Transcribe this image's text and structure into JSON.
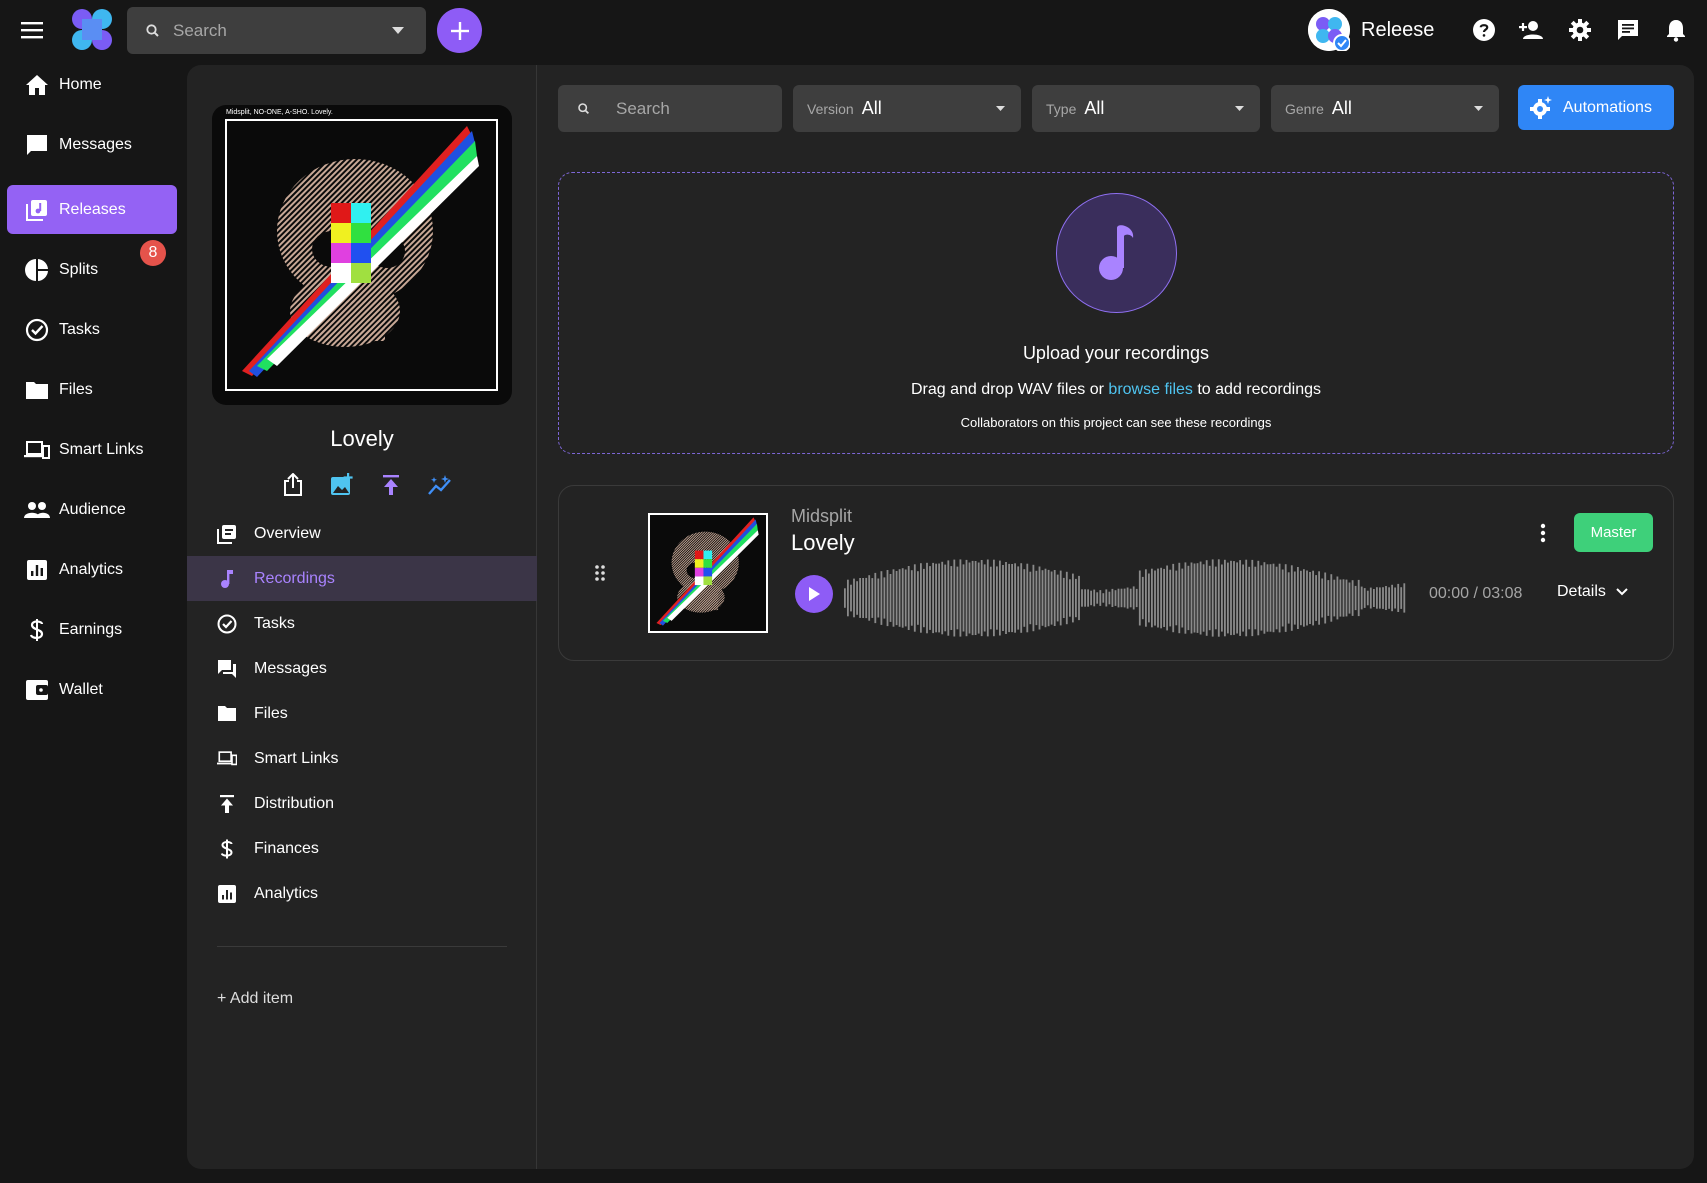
{
  "topbar": {
    "search_placeholder": "Search",
    "account_name": "Releese"
  },
  "sidebar": {
    "items": [
      {
        "label": "Home",
        "icon": "home-icon"
      },
      {
        "label": "Messages",
        "icon": "chat-icon"
      },
      {
        "label": "Releases",
        "icon": "releases-icon"
      },
      {
        "label": "Splits",
        "icon": "pie-icon"
      },
      {
        "label": "Tasks",
        "icon": "check-circle-icon"
      },
      {
        "label": "Files",
        "icon": "folder-icon"
      },
      {
        "label": "Smart Links",
        "icon": "devices-icon"
      },
      {
        "label": "Audience",
        "icon": "people-icon"
      },
      {
        "label": "Analytics",
        "icon": "analytics-icon"
      },
      {
        "label": "Earnings",
        "icon": "dollar-icon"
      },
      {
        "label": "Wallet",
        "icon": "wallet-icon"
      }
    ],
    "active": "Releases",
    "splits_badge": "8"
  },
  "release": {
    "cover_caption": "Midsplit, NO-ONE, A-SHO. Lovely.",
    "title": "Lovely",
    "menu": [
      {
        "label": "Overview",
        "icon": "overview-icon"
      },
      {
        "label": "Recordings",
        "icon": "music-note-icon"
      },
      {
        "label": "Tasks",
        "icon": "check-circle-icon"
      },
      {
        "label": "Messages",
        "icon": "forum-icon"
      },
      {
        "label": "Files",
        "icon": "folder-icon"
      },
      {
        "label": "Smart Links",
        "icon": "devices-icon"
      },
      {
        "label": "Distribution",
        "icon": "publish-icon"
      },
      {
        "label": "Finances",
        "icon": "dollar-icon"
      },
      {
        "label": "Analytics",
        "icon": "analytics-icon"
      }
    ],
    "active_menu": "Recordings",
    "add_item": "+ Add item"
  },
  "filters": {
    "search_placeholder": "Search",
    "version_label": "Version",
    "version_value": "All",
    "type_label": "Type",
    "type_value": "All",
    "genre_label": "Genre",
    "genre_value": "All",
    "automations": "Automations"
  },
  "upload": {
    "title": "Upload your recordings",
    "desc_before": "Drag and drop WAV files or ",
    "desc_link": "browse files",
    "desc_after": " to add recordings",
    "note": "Collaborators on this project can see these recordings"
  },
  "recording": {
    "artist": "Midsplit",
    "title": "Lovely",
    "tag": "Master",
    "time": "00:00 / 03:08",
    "details": "Details",
    "progress": 0
  },
  "colors": {
    "accent": "#8e5cf6",
    "blue": "#2f86f6",
    "green": "#3ed07a",
    "badge": "#e5534b",
    "link": "#4fc4f0"
  }
}
